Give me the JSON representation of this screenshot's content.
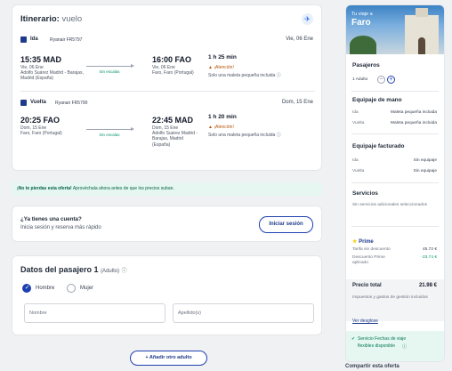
{
  "itinerary": {
    "title": "Itinerario:",
    "title_suffix": "vuelo",
    "outbound": {
      "label": "Ida",
      "carrier": "Ryanair FR5797",
      "date_header": "Vie, 06 Ene",
      "dep_time": "15:35 MAD",
      "dep_date": "Vie, 06 Ene",
      "dep_place": "Adolfo Suárez Madrid - Barajas, Madrid (España)",
      "stops": "Sin escalas",
      "arr_time": "16:00 FAO",
      "arr_date": "Vie, 06 Ene",
      "arr_place": "Faro, Faro (Portugal)",
      "duration": "1 h 25 min",
      "warning": "¡Atención!",
      "baggage": "Solo una maleta pequeña incluida"
    },
    "return": {
      "label": "Vuelta",
      "carrier": "Ryanair FR5790",
      "date_header": "Dom, 15 Ene",
      "dep_time": "20:25 FAO",
      "dep_date": "Dom, 15 Ene",
      "dep_place": "Faro, Faro (Portugal)",
      "stops": "Sin escalas",
      "arr_time": "22:45 MAD",
      "arr_date": "Dom, 15 Ene",
      "arr_place": "Adolfo Suárez Madrid - Barajas, Madrid (España)",
      "duration": "1 h 20 min",
      "warning": "¡Atención!",
      "baggage": "Solo una maleta pequeña incluida"
    }
  },
  "promo": {
    "bold": "¡No te pierdas esta oferta!",
    "text": "Aprovéchala ahora antes de que los precios suban."
  },
  "login": {
    "question": "¿Ya tienes una cuenta?",
    "subtitle": "Inicia sesión y reserva más rápido",
    "button": "Iniciar sesión"
  },
  "passenger": {
    "title": "Datos del pasajero 1",
    "type": "(Adulto)",
    "gender_options": [
      "Hombre",
      "Mujer"
    ],
    "selected_gender": "Hombre",
    "name_placeholder": "Nombre",
    "surname_placeholder": "Apellido(s)"
  },
  "add_adult_button": "+ Añadir otro adulto",
  "sidebar": {
    "kicker": "Tu viaje a",
    "city": "Faro",
    "passengers_heading": "Pasajeros",
    "passengers_value": "1 Adulto",
    "hand_luggage_heading": "Equipaje de mano",
    "hand_rows": [
      {
        "k": "Ida",
        "v": "Maleta pequeña incluida"
      },
      {
        "k": "Vuelta",
        "v": "Maleta pequeña incluida"
      }
    ],
    "checked_heading": "Equipaje facturado",
    "checked_rows": [
      {
        "k": "Ida",
        "v": "Sin equipaje"
      },
      {
        "k": "Vuelta",
        "v": "Sin equipaje"
      }
    ],
    "services_heading": "Servicios",
    "services_text": "Sin servicios adicionales seleccionados",
    "prime_label": "Prime",
    "fare_label": "Tarifa sin descuento",
    "fare_value": "45.72 €",
    "discount_label": "Descuento Prime aplicado",
    "discount_value": "-23.74 €",
    "total_label": "Precio total",
    "total_value": "21.98 €",
    "taxes_note": "Impuestos y gastos de gestión incluidos",
    "breakdown_link": "Ver desglose",
    "service_line1": "Servicio Fechas de viaje",
    "service_line2": "flexibles disponible"
  },
  "share": "Compartir esta oferta",
  "colors": {
    "accent": "#1e3a8a",
    "promo_bg": "#e6f7f1",
    "warning": "#b45309",
    "success": "#059669"
  }
}
